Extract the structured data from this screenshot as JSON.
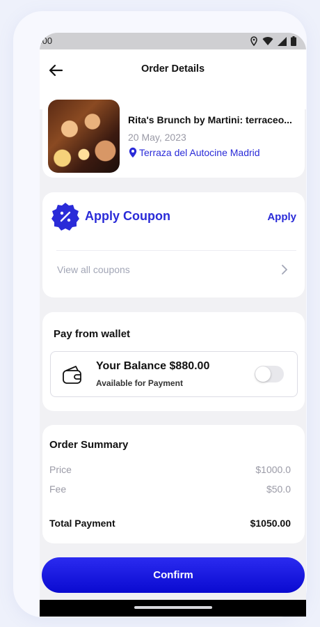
{
  "status_bar": {
    "time": ":00",
    "icons": [
      "location-icon",
      "wifi-icon",
      "signal-icon",
      "battery-icon"
    ]
  },
  "app_bar": {
    "title": "Order Details",
    "back_icon": "arrow-left-icon"
  },
  "event": {
    "name": "Rita's Brunch by Martini: terraceo...",
    "date": "20 May, 2023",
    "location": "Terraza del Autocine Madrid"
  },
  "coupon": {
    "title": "Apply Coupon",
    "apply_label": "Apply",
    "view_all_label": "View all coupons"
  },
  "wallet": {
    "heading": "Pay from wallet",
    "balance_text": "Your Balance $880.00",
    "available_text": "Available for Payment",
    "toggle_on": false
  },
  "summary": {
    "heading": "Order Summary",
    "price_label": "Price",
    "price_value": "$1000.0",
    "fee_label": "Fee",
    "fee_value": "$50.0",
    "total_label": "Total Payment",
    "total_value": "$1050.00"
  },
  "confirm_label": "Confirm",
  "colors": {
    "accent": "#2a2bd8",
    "button_top": "#2b2bf0",
    "button_bottom": "#0a0ad0"
  }
}
